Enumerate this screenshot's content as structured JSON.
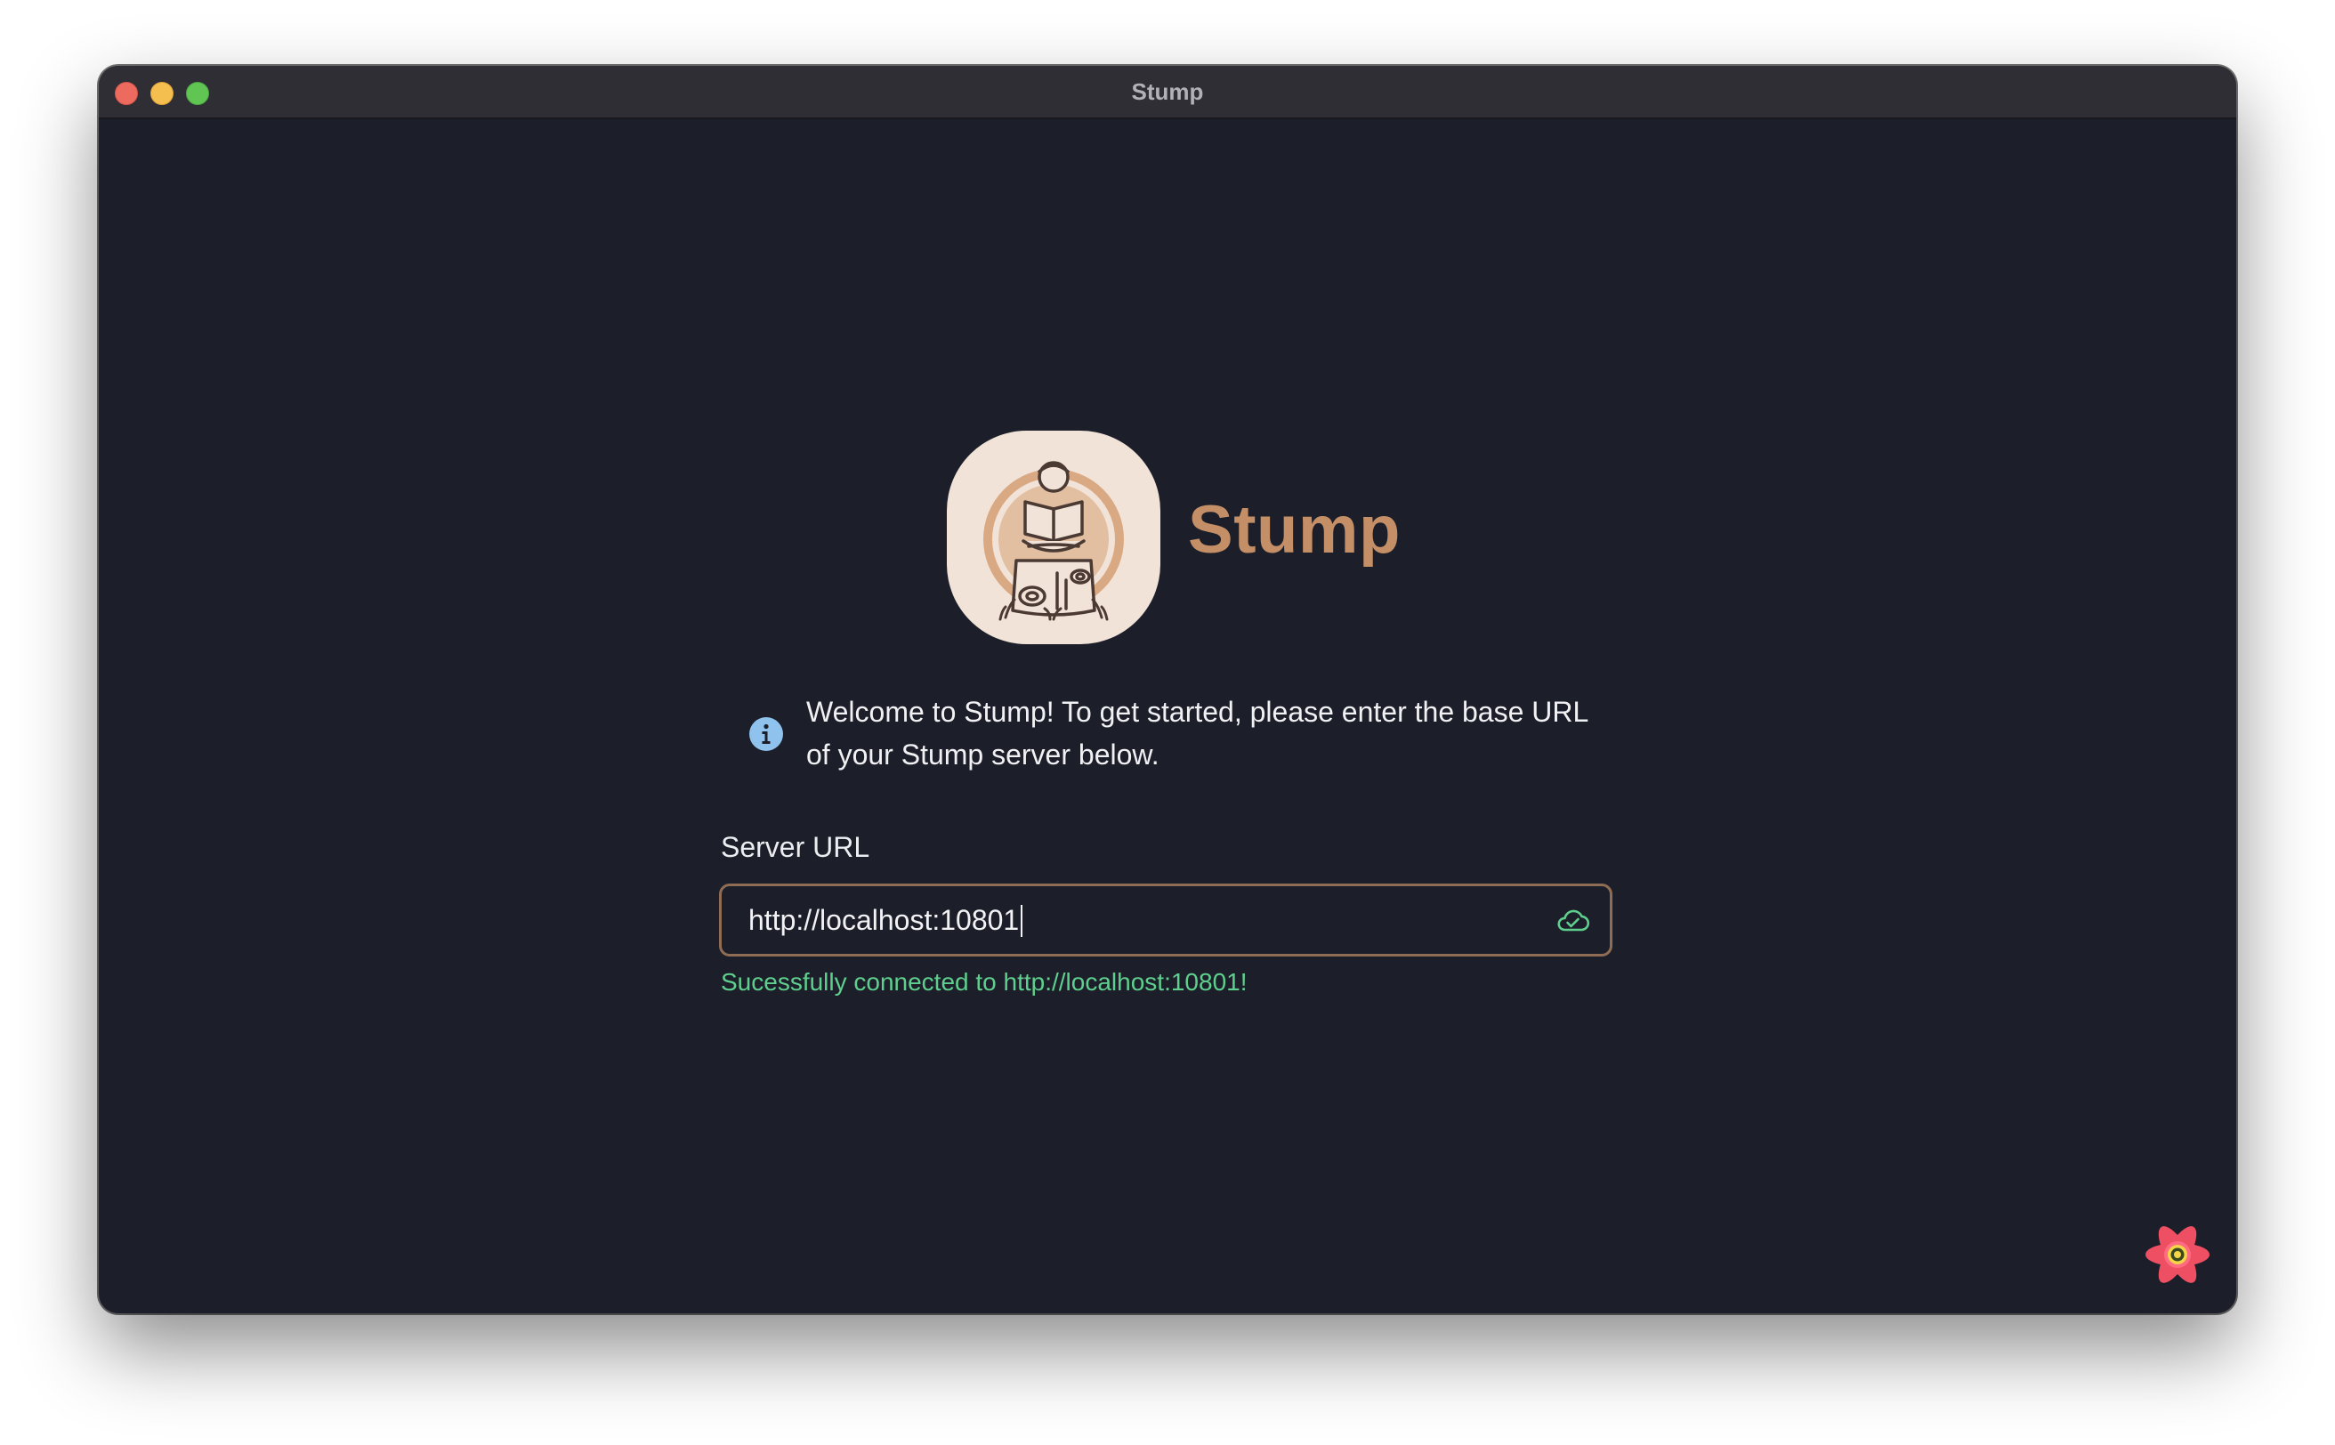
{
  "window": {
    "title": "Stump"
  },
  "brand": {
    "name": "Stump",
    "logo_icon": "stump-reader-logo-icon",
    "accent_color": "#c48f66"
  },
  "info": {
    "icon": "info-icon",
    "message": "Welcome to Stump! To get started, please enter the base URL of your Stump server below."
  },
  "server_url": {
    "label": "Server URL",
    "value": "http://localhost:10801",
    "status_icon": "cloud-check-icon",
    "status_message": "Sucessfully connected to http://localhost:10801!",
    "status_color": "#5fcf8e"
  },
  "devtools": {
    "icon": "react-query-devtools-icon"
  }
}
